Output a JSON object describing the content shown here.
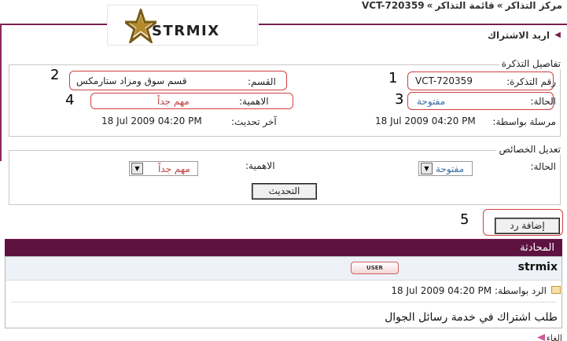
{
  "breadcrumb": {
    "items": [
      "مركز التذاكر",
      "قائمة التذاكر",
      "VCT-720359"
    ],
    "separator": "»"
  },
  "logo": {
    "text": "STRMIX"
  },
  "page_title": "اريد الاشتراك",
  "ticket_details": {
    "legend": "تفاصيل التذكرة",
    "ticket_number_label": "رقم التذكرة:",
    "ticket_number": "VCT-720359",
    "department_label": "القسم:",
    "department": "قسم سوق ومزاد ستارمكس",
    "status_label": "الحالة:",
    "status": "مفتوحة",
    "priority_label": "الاهمية:",
    "priority": "مهم جداً",
    "sent_by_label": "مرسلة بواسطة:",
    "sent_date": "18 Jul 2009 04:20 PM",
    "updated_label": "آخر تحديث:",
    "updated_date": "18 Jul 2009 04:20 PM"
  },
  "annotations": {
    "n1": "1",
    "n2": "2",
    "n3": "3",
    "n4": "4",
    "n5": "5"
  },
  "edit_properties": {
    "legend": "تعديل الخصائص",
    "status_label": "الحالة:",
    "status_selected": "مفتوحة",
    "priority_label": "الاهمية:",
    "priority_selected": "مهم جداً",
    "update_button": "التحديث"
  },
  "add_reply_button": "إضافة رد",
  "conversation": {
    "header": "المحادثة",
    "username": "strmix",
    "badge": "USER",
    "reply_by_label": "الرد بواسطة:",
    "reply_date": "18 Jul 2009 04:20 PM",
    "message": "طلب اشتراك في خدمة رسائل الجوال"
  },
  "bottom_partial": "الغاء",
  "colors": {
    "accent": "#7a1f4f",
    "header_bg": "#5e1240",
    "status_text": "#3a6ea5",
    "priority_text": "#c04040",
    "annotation_border": "#d04040"
  }
}
